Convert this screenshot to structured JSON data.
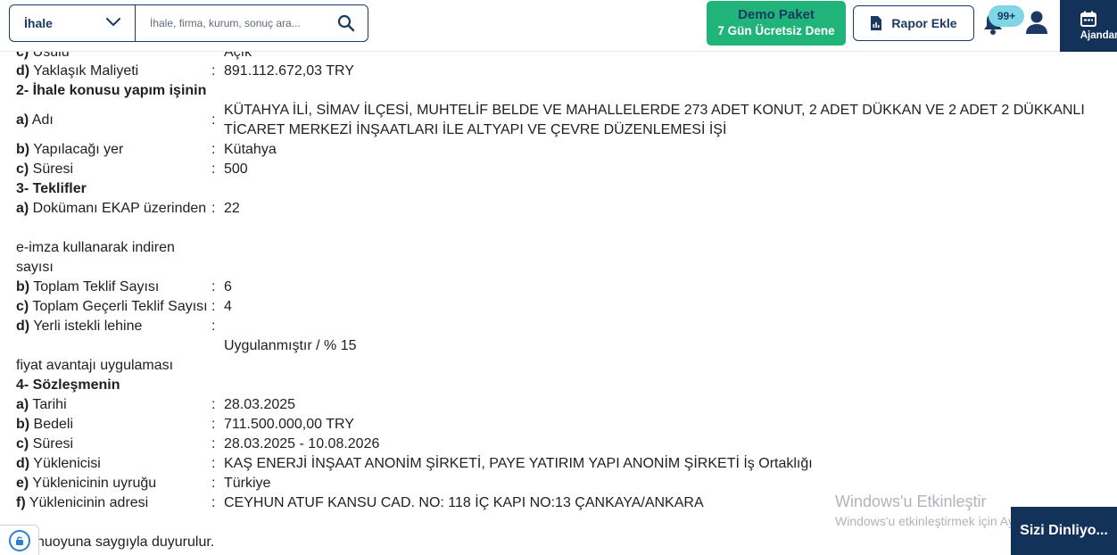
{
  "topbar": {
    "category_label": "İhale",
    "search_placeholder": "İhale, firma, kurum, sonuç ara...",
    "demo_line1": "Demo Paket",
    "demo_line2": "7 Gün Ücretsiz Dene",
    "report_label": "Rapor Ekle",
    "notification_count": "99+",
    "agenda_label": "Ajandam",
    "accent_color": "#13325a",
    "demo_color": "#21b47a"
  },
  "content": {
    "row_c_usulu": {
      "prefix": "c)",
      "label": " Usulü",
      "value": "Açık"
    },
    "row_d_maliyet": {
      "prefix": "d)",
      "label": " Yaklaşık Maliyeti",
      "value": "891.112.672,03 TRY"
    },
    "section2": "2- İhale konusu yapım işinin",
    "row_a_adi": {
      "prefix": "a)",
      "label": " Adı",
      "value": "KÜTAHYA İLİ, SİMAV İLÇESİ, MUHTELİF BELDE VE MAHALLELERDE 273 ADET KONUT, 2 ADET DÜKKAN VE 2 ADET 2 DÜKKANLI TİCARET MERKEZİ İNŞAATLARI İLE ALTYAPI VE ÇEVRE DÜZENLEMESİ İŞİ"
    },
    "row_b_yer": {
      "prefix": "b)",
      "label": " Yapılacağı yer",
      "value": "Kütahya"
    },
    "row_c_suresi": {
      "prefix": "c)",
      "label": " Süresi",
      "value": "500"
    },
    "section3": "3- Teklifler",
    "row_a_dokuman": {
      "prefix": "a)",
      "label": " Dokümanı EKAP üzerinden",
      "value": "22"
    },
    "eimza_line1": "e-imza kullanarak indiren",
    "eimza_line2": "sayısı",
    "row_b_teklif": {
      "prefix": "b)",
      "label": " Toplam Teklif Sayısı",
      "value": "6"
    },
    "row_c_gecerli": {
      "prefix": "c)",
      "label": " Toplam Geçerli Teklif Sayısı",
      "value": "4"
    },
    "row_d_yerli": {
      "prefix": "d)",
      "label": " Yerli istekli lehine",
      "value": ""
    },
    "yerli_value": "Uygulanmıştır / % 15",
    "fiyat_line": "fiyat avantajı uygulaması",
    "section4": "4- Sözleşmenin",
    "row_a_tarihi": {
      "prefix": "a)",
      "label": " Tarihi",
      "value": "28.03.2025"
    },
    "row_b_bedeli": {
      "prefix": "b)",
      "label": " Bedeli",
      "value": "711.500.000,00 TRY"
    },
    "row_c_sure": {
      "prefix": "c)",
      "label": " Süresi",
      "value": "28.03.2025 - 10.08.2026"
    },
    "row_d_yuklenici": {
      "prefix": "d)",
      "label": " Yüklenicisi",
      "value": "KAŞ ENERJİ İNŞAAT ANONİM ŞİRKETİ, PAYE YATIRIM YAPI ANONİM ŞİRKETİ İş Ortaklığı"
    },
    "row_e_uyruk": {
      "prefix": "e)",
      "label": " Yüklenicinin uyruğu",
      "value": "Türkiye"
    },
    "row_f_adres": {
      "prefix": "f)",
      "label": " Yüklenicinin adresi",
      "value": "CEYHUN ATUF KANSU CAD. NO: 118 İÇ KAPI NO:13 ÇANKAYA/ANKARA"
    },
    "colon": ":",
    "footer": "nuoyuna saygıyla duyurulur."
  },
  "overlay": {
    "watermark_title": "Windows'u Etkinleştir",
    "watermark_sub": "Windows'u etkinleştirmek için Ayarlar'a gidin.",
    "chat_label": "Sizi Dinliyo..."
  }
}
